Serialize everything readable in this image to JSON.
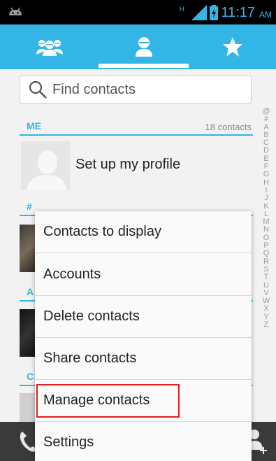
{
  "status_bar": {
    "time": "11:17",
    "ampm": "AM",
    "network_type": "H"
  },
  "tabs": [
    {
      "name": "groups",
      "icon": "groups-icon"
    },
    {
      "name": "all-contacts",
      "icon": "person-icon",
      "selected": true
    },
    {
      "name": "favorites",
      "icon": "star-icon"
    }
  ],
  "search": {
    "placeholder": "Find contacts"
  },
  "list": {
    "me_header": "ME",
    "count": "18 contacts",
    "profile_label": "Set up my profile",
    "hash_header": "#",
    "a_header": "A",
    "c_header": "C"
  },
  "alphabet": [
    "@",
    "#",
    "A",
    "B",
    "C",
    "D",
    "E",
    "F",
    "G",
    "H",
    "I",
    "J",
    "K",
    "L",
    "M",
    "N",
    "O",
    "P",
    "Q",
    "R",
    "S",
    "T",
    "U",
    "V",
    "W",
    "X",
    "Y",
    "Z"
  ],
  "menu": {
    "items": [
      {
        "label": "Contacts to display"
      },
      {
        "label": "Accounts"
      },
      {
        "label": "Delete contacts"
      },
      {
        "label": "Share contacts"
      },
      {
        "label": "Manage contacts"
      },
      {
        "label": "Settings"
      }
    ]
  },
  "colors": {
    "accent": "#33b5e5",
    "highlight": "#e02020"
  }
}
